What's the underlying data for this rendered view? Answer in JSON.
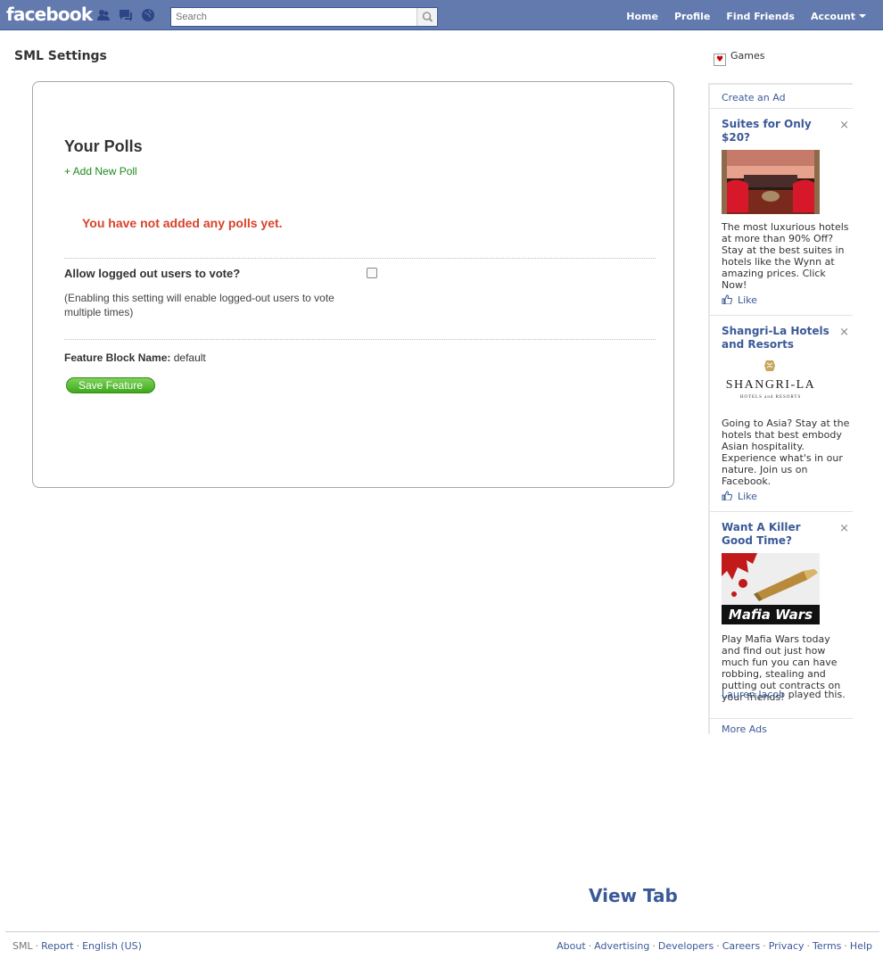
{
  "topbar": {
    "logo": "facebook",
    "search_placeholder": "Search",
    "nav": [
      "Home",
      "Profile",
      "Find Friends",
      "Account"
    ],
    "bg_color": "#627aad"
  },
  "page_title": "SML Settings",
  "polls": {
    "title": "Your Polls",
    "add_link": "+ Add New Poll",
    "empty_message": "You have not added any polls yet.",
    "vote_label": "Allow logged out users to vote?",
    "vote_checked": false,
    "vote_help": "(Enabling this setting will enable logged-out users to vote multiple times)",
    "block_name_label": "Feature Block Name:",
    "block_name_value": "default",
    "save_label": "Save Feature"
  },
  "sidebar": {
    "games_label": "Games",
    "create_ad": "Create an Ad",
    "ads": [
      {
        "title": "Suites for Only $20?",
        "body": "The most luxurious hotels at more than 90% Off? Stay at the best suites in hotels like the Wynn at amazing prices. Click Now!",
        "like": "Like",
        "image": "hotel-suite-photo"
      },
      {
        "title": "Shangri-La Hotels and Resorts",
        "logo_text": "SHANGRI-LA",
        "logo_subtext": "HOTELS and RESORTS",
        "body": "Going to Asia? Stay at the hotels that best embody Asian hospitality. Experience what's in our nature. Join us on Facebook.",
        "like": "Like",
        "image": "shangri-la-logo"
      },
      {
        "title": "Want A Killer Good Time?",
        "image_text": "Mafia Wars",
        "body": "Play Mafia Wars today and find out just how much fun you can have robbing, stealing and putting out contracts on your friends!",
        "friend_name": "Lauren Jacob",
        "friend_action": "played this.",
        "image": "mafia-wars-bullet"
      }
    ],
    "more_ads": "More Ads"
  },
  "view_tab": "View Tab",
  "footer": {
    "left": [
      "SML",
      "Report",
      "English (US)"
    ],
    "right": [
      "About",
      "Advertising",
      "Developers",
      "Careers",
      "Privacy",
      "Terms",
      "Help"
    ]
  }
}
